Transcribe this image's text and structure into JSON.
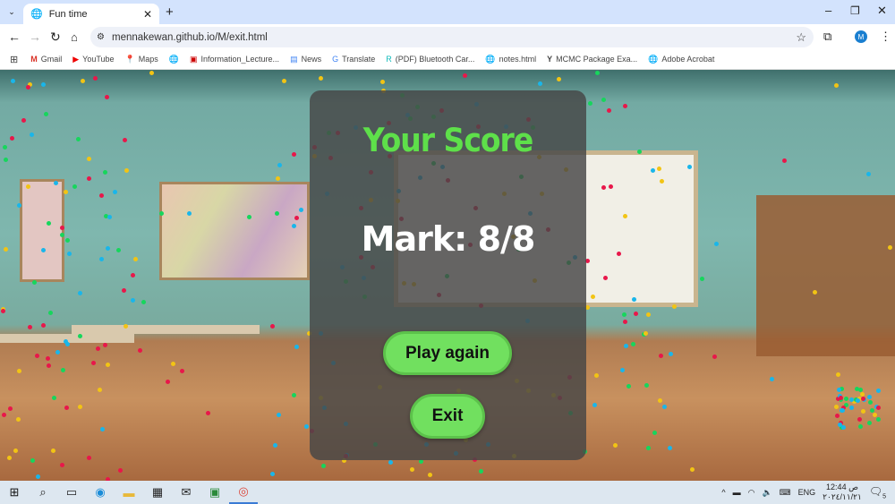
{
  "browser": {
    "tab_title": "Fun time",
    "url": "mennakewan.github.io/M/exit.html",
    "profile_initial": "M",
    "bookmarks": [
      "Gmail",
      "YouTube",
      "Maps",
      "Information_Lecture...",
      "News",
      "Translate",
      "(PDF) Bluetooth Car...",
      "notes.html",
      "MCMC Package Exa...",
      "Adobe Acrobat"
    ]
  },
  "game": {
    "title": "Your Score",
    "mark": "Mark: 8/8",
    "play_again": "Play again",
    "exit": "Exit",
    "confetti_colors": [
      "#e8174a",
      "#16d65c",
      "#19b6ea",
      "#f2c414"
    ]
  },
  "taskbar": {
    "time": "12:44 ص",
    "date": "٢٠٢٤/١١/٢١",
    "language": "ENG",
    "notifications": "5"
  }
}
